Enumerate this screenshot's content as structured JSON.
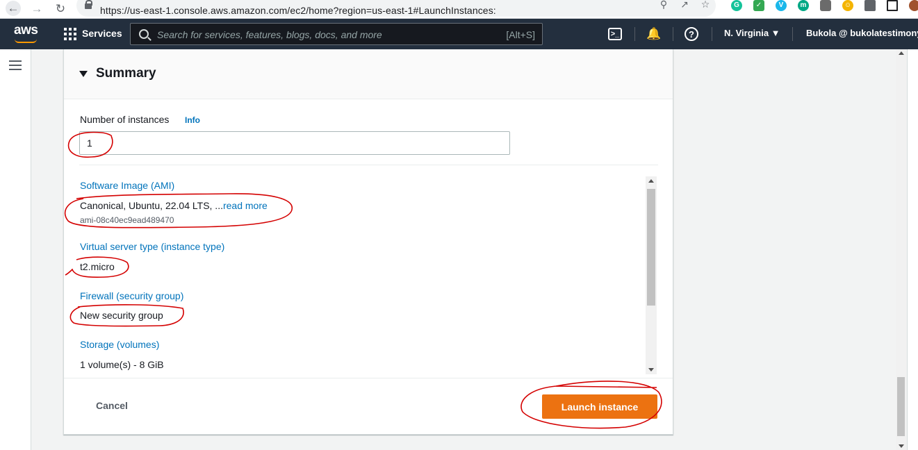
{
  "browser": {
    "url": "https://us-east-1.console.aws.amazon.com/ec2/home?region=us-east-1#LaunchInstances:"
  },
  "aws_nav": {
    "logo": "aws",
    "services_label": "Services",
    "search_placeholder": "Search for services, features, blogs, docs, and more",
    "search_shortcut": "[Alt+S]",
    "region": "N. Virginia ▼",
    "account": "Bukola @ bukolatestimony"
  },
  "summary": {
    "title": "Summary",
    "instances_label": "Number of instances",
    "info_link": "Info",
    "instances_value": "1",
    "ami_label": "Software Image (AMI)",
    "ami_value": "Canonical, Ubuntu, 22.04 LTS, ...",
    "ami_read_more": "read more",
    "ami_id": "ami-08c40ec9ead489470",
    "instance_type_label": "Virtual server type (instance type)",
    "instance_type_value": "t2.micro",
    "firewall_label": "Firewall (security group)",
    "firewall_value": "New security group",
    "storage_label": "Storage (volumes)",
    "storage_value": "1 volume(s) - 8 GiB"
  },
  "footer": {
    "cancel_label": "Cancel",
    "launch_label": "Launch instance"
  },
  "colors": {
    "nav_bg": "#232f3e",
    "link": "#0073bb",
    "primary_button": "#ec7211",
    "annotation": "#d40000"
  }
}
